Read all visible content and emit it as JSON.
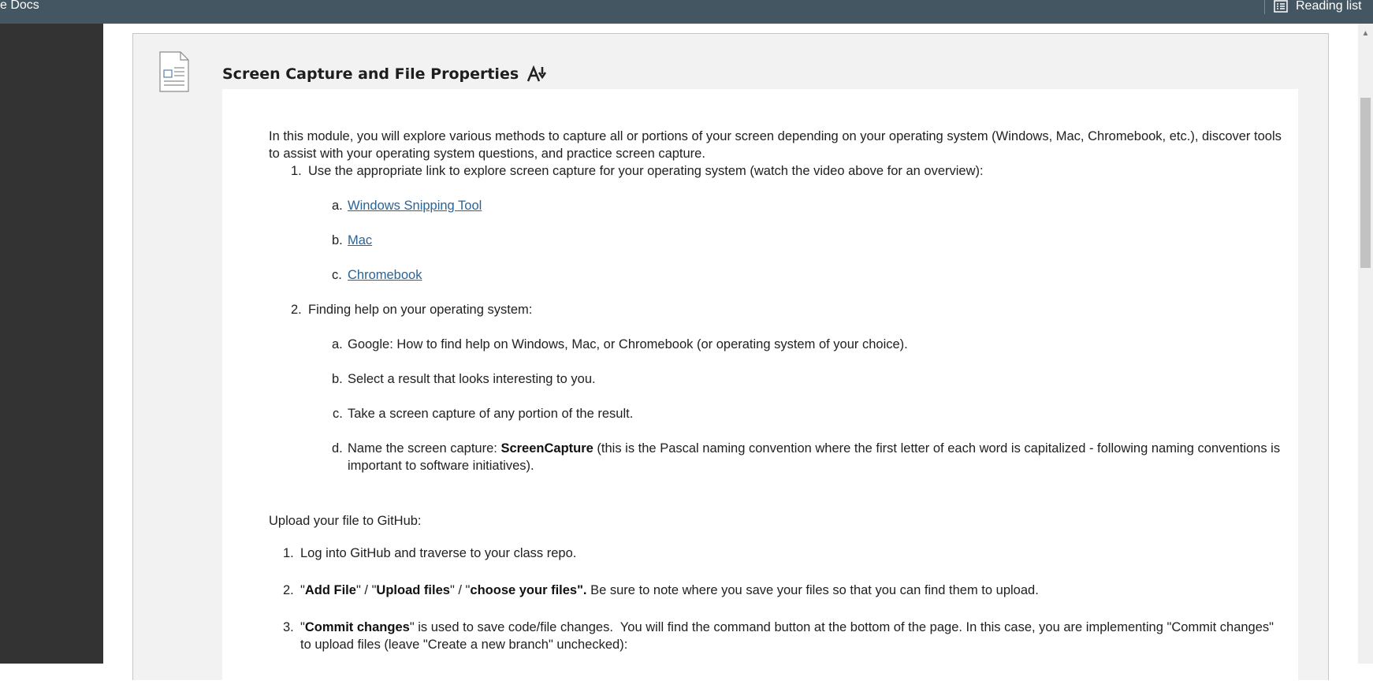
{
  "bookmarks_bar": {
    "bookmark_label": "e Docs",
    "reading_list_label": "Reading list"
  },
  "module": {
    "title": "Screen Capture and File Properties",
    "intro": "In this module, you will explore various methods to capture all or portions of your screen depending on your operating system (Windows, Mac, Chromebook, etc.), discover tools to assist with your operating system questions, and practice screen capture.",
    "step1": {
      "num": "1.",
      "text": "Use the appropriate link to explore screen capture for your operating system (watch the video above for an overview):",
      "links": [
        {
          "marker": "a.",
          "label": "Windows Snipping Tool"
        },
        {
          "marker": "b.",
          "label": "Mac"
        },
        {
          "marker": "c.",
          "label": "Chromebook"
        }
      ]
    },
    "step2": {
      "num": "2.",
      "text": "Finding help on your operating system:",
      "items": [
        {
          "marker": "a.",
          "text": "Google: How to find help on Windows, Mac, or Chromebook (or operating system of your choice)."
        },
        {
          "marker": "b.",
          "text": "Select a result that looks interesting to you."
        },
        {
          "marker": "c.",
          "text": "Take a screen capture of any portion of the result."
        },
        {
          "marker": "d.",
          "prefix": "Name the screen capture: ",
          "bold": "ScreenCapture",
          "line1_rest": " (this is the Pascal naming convention where the first letter of each word is capitalized - following naming conventions is",
          "line2": "important to software initiatives)."
        }
      ]
    },
    "upload": {
      "heading": "Upload your file to GitHub:",
      "steps": [
        {
          "num": "1.",
          "text": "Log into GitHub and traverse to your class repo."
        },
        {
          "num": "2.",
          "q1": "\"",
          "b1": "Add File",
          "s1": "\" / \"",
          "b2": "Upload files",
          "s2": "\" / \"",
          "b3": "choose your files\".",
          "rest": " Be sure to note where you save your files so that you can find them to upload."
        },
        {
          "num": "3.",
          "q1": "\"",
          "b1": "Commit changes",
          "line1_rest": "\" is used to save code/file changes.  You will find the command button at the bottom of the page. In this case, you are implementing \"Commit changes\"",
          "line2": "to upload files (leave \"Create a new branch\" unchecked):"
        }
      ]
    }
  }
}
